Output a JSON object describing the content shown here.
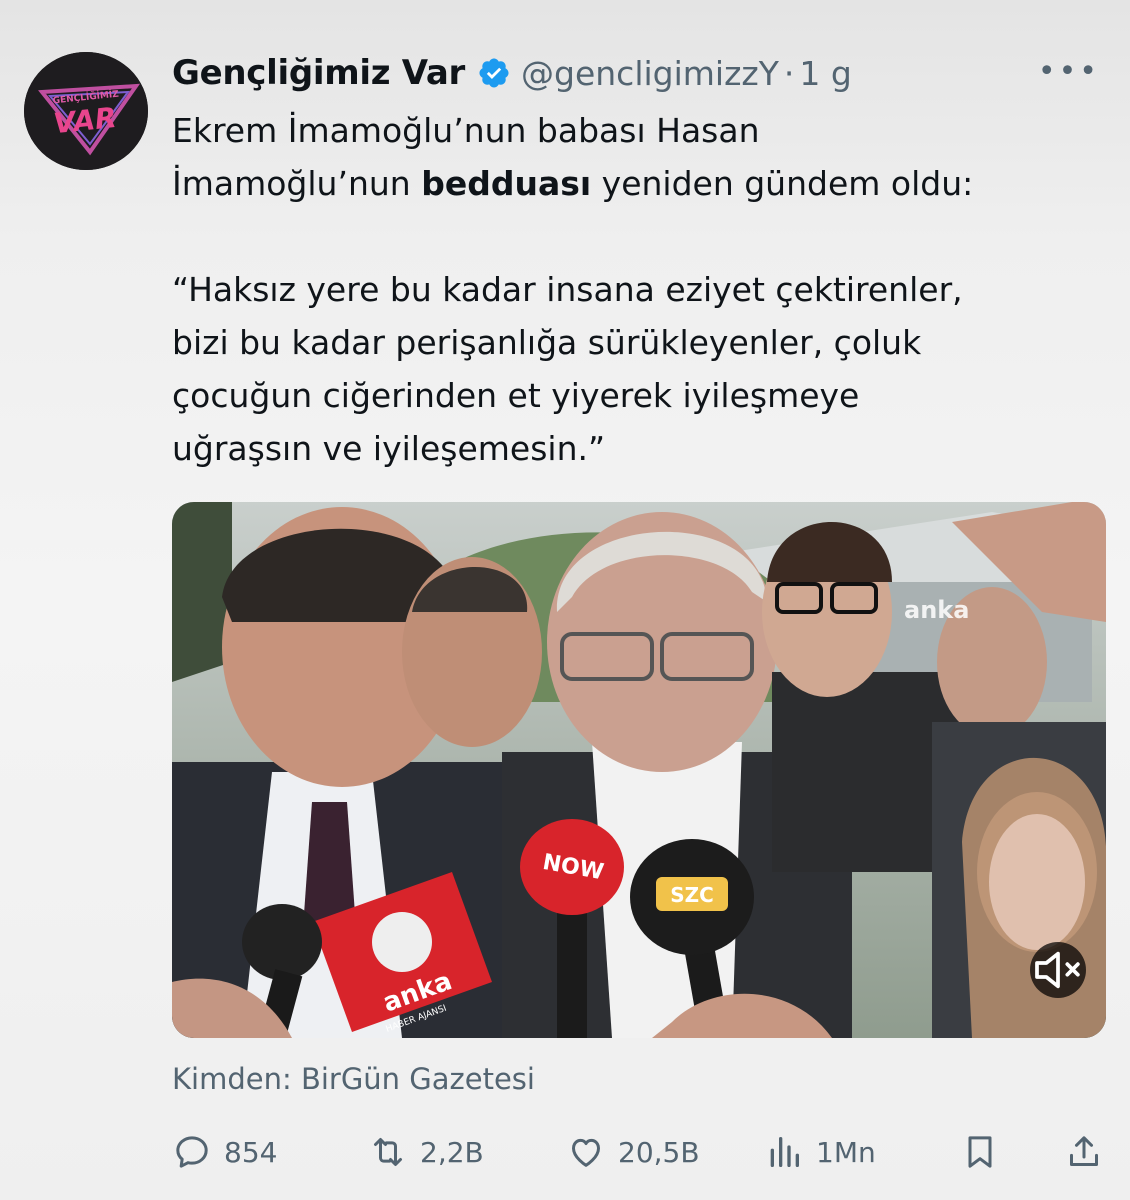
{
  "author": {
    "display_name": "Gençliğimiz Var",
    "handle": "@gencligimizzY",
    "separator": "·",
    "time": "1 g",
    "avatar_text_top": "GENÇLİĞİMİZ",
    "avatar_text_main": "VAR"
  },
  "tweet": {
    "line1": "Ekrem İmamoğlu’nun babası Hasan",
    "line2_prefix": "İmamoğlu’nun ",
    "line2_bold": "bedduası",
    "line2_suffix": " yeniden gündem oldu:",
    "quote": "“Haksız yere bu kadar insana eziyet çektirenler,\nbizi bu kadar perişanlığa sürükleyenler, çoluk\nçocuğun ciğerinden et yiyerek iyileşmeye\nuğraşsın ve iyileşemesin.”"
  },
  "media": {
    "watermark": "anka",
    "mic_labels": {
      "now": "NOW",
      "szc": "SZC",
      "anka": "anka",
      "anka_sub": "HABER AJANSI"
    }
  },
  "source": "Kimden: BirGün Gazetesi",
  "actions": {
    "replies": "854",
    "reposts": "2,2B",
    "likes": "20,5B",
    "views": "1Mn"
  },
  "colors": {
    "text": "#0f1419",
    "secondary": "#536471",
    "verified": "#1d9bf0",
    "now_red": "#d8242b"
  }
}
